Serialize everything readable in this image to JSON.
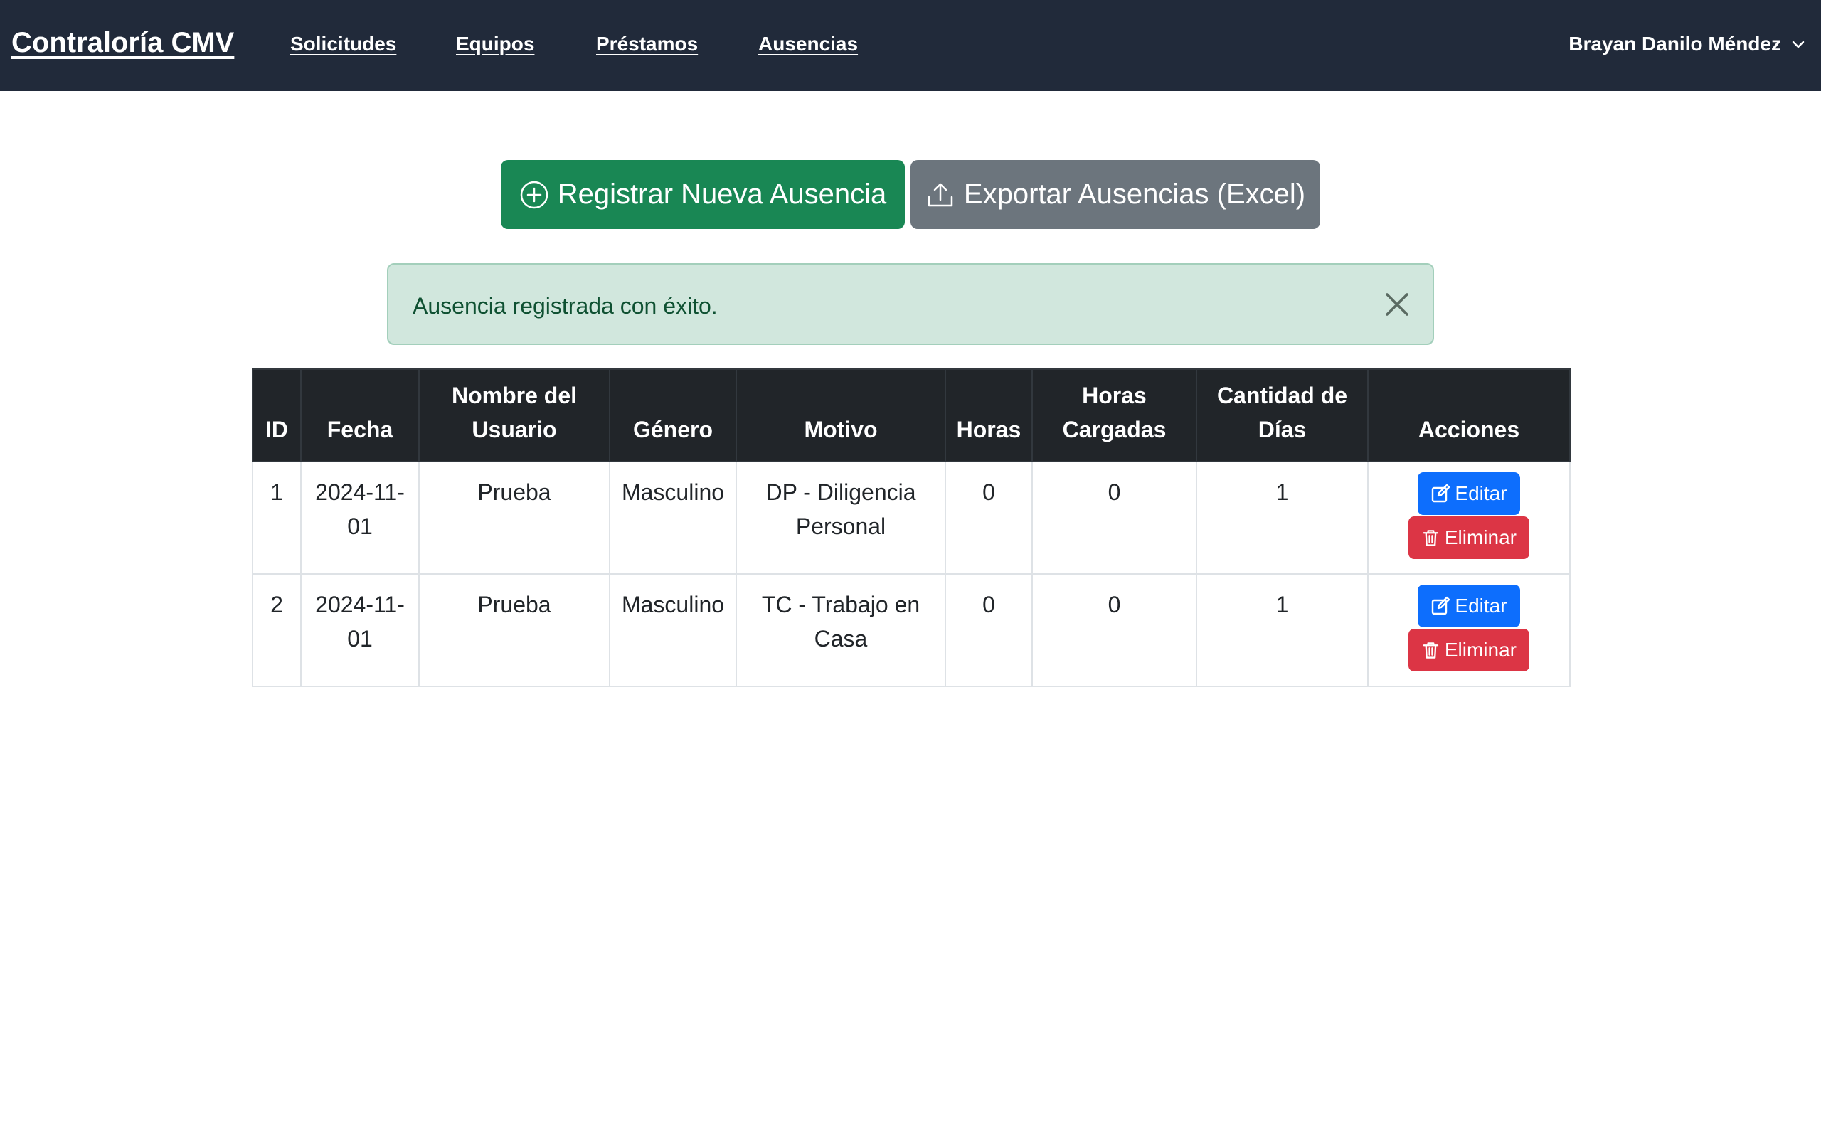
{
  "navbar": {
    "brand": "Contraloría CMV",
    "links": [
      "Solicitudes",
      "Equipos",
      "Préstamos",
      "Ausencias"
    ],
    "user": "Brayan Danilo Méndez",
    "user_icon": "chevron-down-icon"
  },
  "actions": {
    "register_label": "Registrar Nueva Ausencia",
    "register_icon": "plus-circle-icon",
    "export_label": "Exportar Ausencias (Excel)",
    "export_icon": "upload-icon"
  },
  "alert": {
    "message": "Ausencia registrada con éxito.",
    "close_icon": "close-icon"
  },
  "table": {
    "headers": [
      "ID",
      "Fecha",
      "Nombre del Usuario",
      "Género",
      "Motivo",
      "Horas",
      "Horas Cargadas",
      "Cantidad de Días",
      "Acciones"
    ],
    "rows": [
      {
        "id": "1",
        "fecha": "2024-11-01",
        "nombre": "Prueba",
        "genero": "Masculino",
        "motivo": "DP - Diligencia Personal",
        "horas": "0",
        "horas_cargadas": "0",
        "dias": "1"
      },
      {
        "id": "2",
        "fecha": "2024-11-01",
        "nombre": "Prueba",
        "genero": "Masculino",
        "motivo": "TC - Trabajo en Casa",
        "horas": "0",
        "horas_cargadas": "0",
        "dias": "1"
      }
    ],
    "edit_label": "Editar",
    "edit_icon": "edit-icon",
    "delete_label": "Eliminar",
    "delete_icon": "trash-icon"
  },
  "colors": {
    "navbar": "#212a3a",
    "success_button": "#198754",
    "secondary_button": "#6c757d",
    "alert_bg": "#d1e7dd",
    "alert_text": "#0f5132",
    "table_header": "#212529",
    "edit_button": "#0d6efd",
    "delete_button": "#dc3545"
  }
}
